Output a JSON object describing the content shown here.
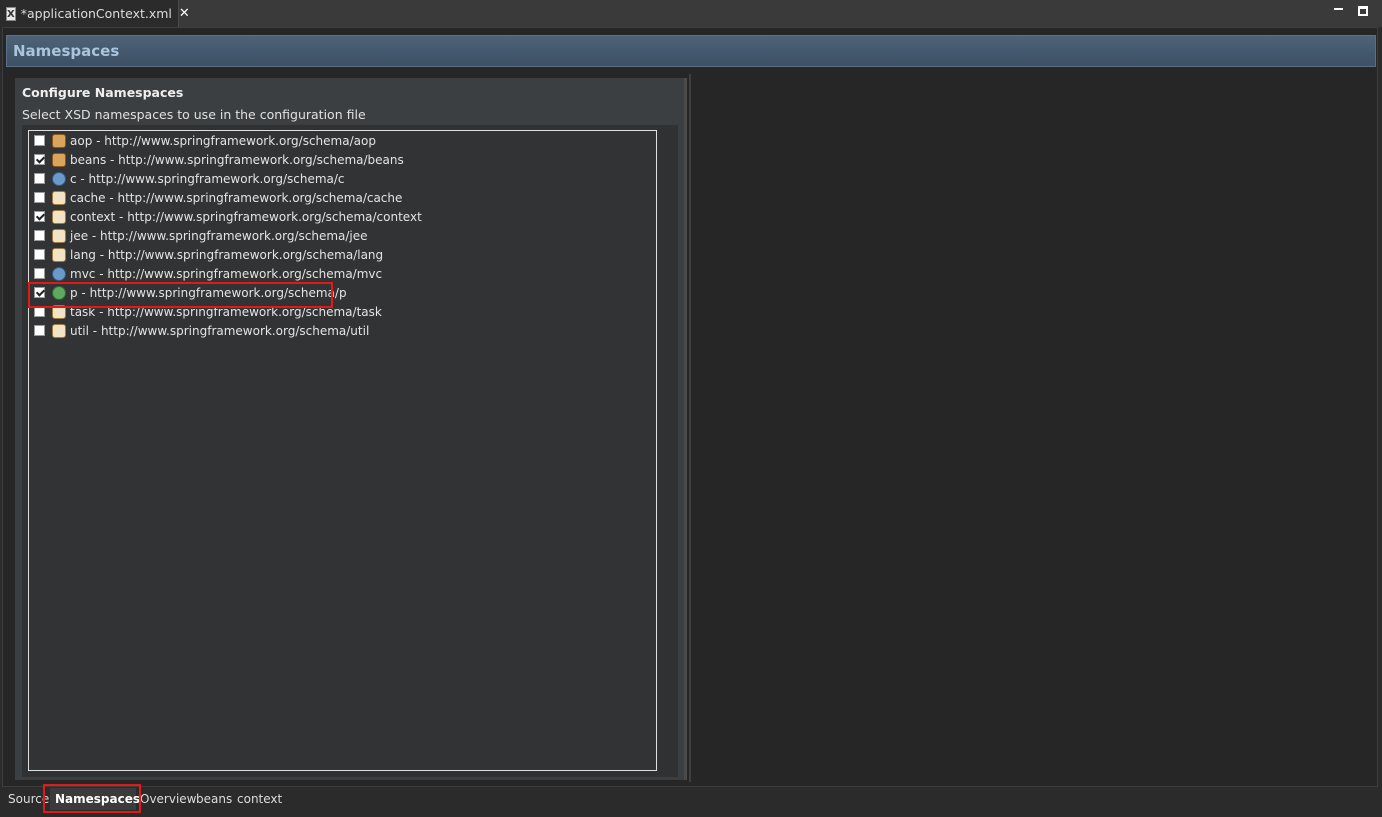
{
  "editor": {
    "tab_title": "*applicationContext.xml",
    "tab_icon_letter": "X"
  },
  "section": {
    "title": "Namespaces"
  },
  "panel": {
    "title": "Configure Namespaces",
    "description": "Select XSD namespaces to use in the configuration file"
  },
  "namespaces": [
    {
      "label": "aop - http://www.springframework.org/schema/aop",
      "checked": false,
      "icon": "aop-namespace-icon"
    },
    {
      "label": "beans - http://www.springframework.org/schema/beans",
      "checked": true,
      "icon": "beans-namespace-icon"
    },
    {
      "label": "c - http://www.springframework.org/schema/c",
      "checked": false,
      "icon": "c-namespace-icon"
    },
    {
      "label": "cache - http://www.springframework.org/schema/cache",
      "checked": false,
      "icon": "cache-namespace-icon"
    },
    {
      "label": "context - http://www.springframework.org/schema/context",
      "checked": true,
      "icon": "context-namespace-icon"
    },
    {
      "label": "jee - http://www.springframework.org/schema/jee",
      "checked": false,
      "icon": "jee-namespace-icon"
    },
    {
      "label": "lang - http://www.springframework.org/schema/lang",
      "checked": false,
      "icon": "lang-namespace-icon"
    },
    {
      "label": "mvc - http://www.springframework.org/schema/mvc",
      "checked": false,
      "icon": "mvc-namespace-icon"
    },
    {
      "label": "p - http://www.springframework.org/schema/p",
      "checked": true,
      "icon": "p-namespace-icon"
    },
    {
      "label": "task - http://www.springframework.org/schema/task",
      "checked": false,
      "icon": "task-namespace-icon"
    },
    {
      "label": "util - http://www.springframework.org/schema/util",
      "checked": false,
      "icon": "util-namespace-icon"
    }
  ],
  "bottom_tabs": [
    {
      "label": "Source",
      "active": false
    },
    {
      "label": "Namespaces",
      "active": true
    },
    {
      "label": "Overview",
      "active": false
    },
    {
      "label": "beans",
      "active": false
    },
    {
      "label": "context",
      "active": false
    }
  ],
  "colors": {
    "highlight": "#e01919",
    "header_text": "#a9c4dc"
  }
}
